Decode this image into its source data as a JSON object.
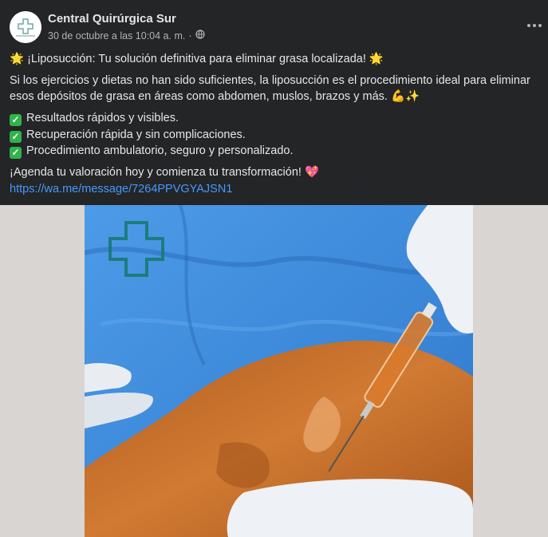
{
  "post": {
    "page_name": "Central Quirúrgica Sur",
    "timestamp": "30 de octubre a las 10:04 a. m.",
    "separator": "·",
    "privacy_icon": "globe-icon",
    "more_icon": "more-options-icon",
    "title_text": " ¡Liposucción: Tu solución definitiva para eliminar grasa localizada! ",
    "title_emoji": "🌟",
    "paragraph_line1": "Si los ejercicios y dietas no han sido suficientes, la liposucción es el procedimiento ideal para eliminar",
    "paragraph_line2": "esos depósitos de grasa en áreas como abdomen, muslos, brazos y más.",
    "paragraph_emoji": "💪✨",
    "check_mark": "✓",
    "bullets": [
      "Resultados rápidos y visibles.",
      "Recuperación rápida y sin complicaciones.",
      "Procedimiento ambulatorio, seguro y personalizado."
    ],
    "cta": "¡Agenda tu valoración hoy y comienza tu transformación!",
    "cta_emoji": "💖",
    "link": "https://wa.me/message/7264PPVGYAJSN1"
  },
  "colors": {
    "background": "#242526",
    "text": "#e4e6eb",
    "secondary_text": "#b0b3b8",
    "link": "#4599ff",
    "check": "#2fb34a",
    "drape": "#3d8be0",
    "skin_prep": "#c8742c"
  }
}
